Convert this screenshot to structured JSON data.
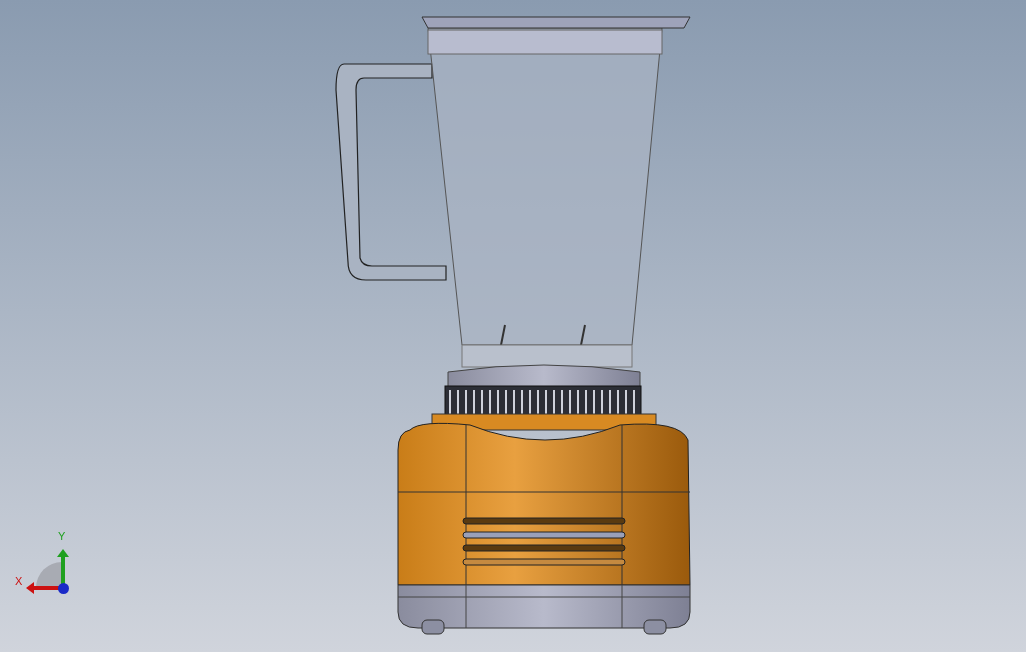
{
  "viewport": {
    "triad": {
      "axes": [
        {
          "kind": "y",
          "label": "Y",
          "color": "#1fa01f"
        },
        {
          "kind": "x",
          "label": "X",
          "color": "#cc1111"
        }
      ]
    }
  }
}
